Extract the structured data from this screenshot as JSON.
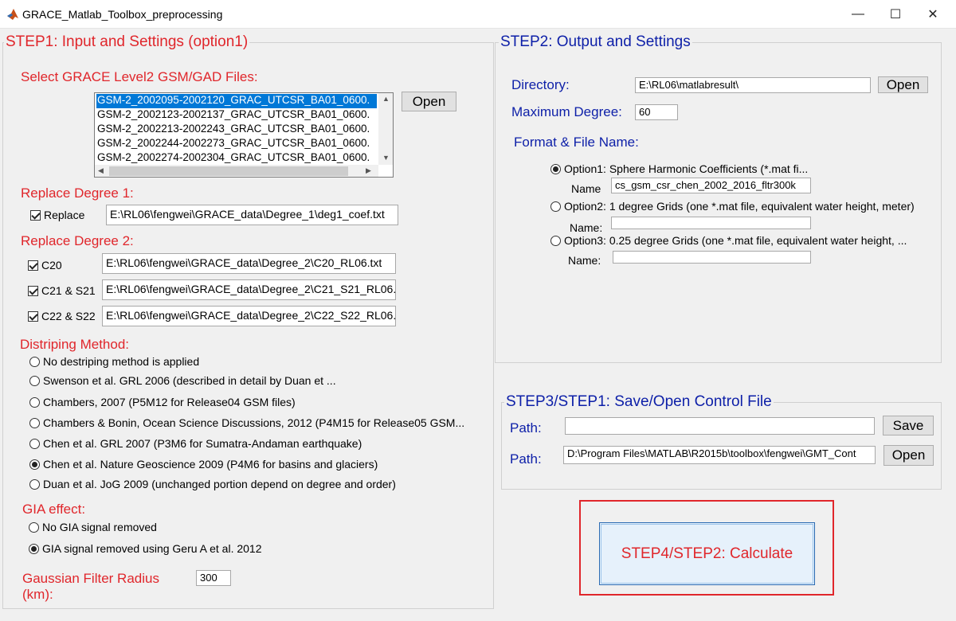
{
  "window": {
    "title": "GRACE_Matlab_Toolbox_preprocessing",
    "controls": [
      "—",
      "☐",
      "✕"
    ]
  },
  "step1": {
    "title": "STEP1: Input and Settings (option1)",
    "select_label": "Select GRACE Level2 GSM/GAD Files:",
    "files": [
      "GSM-2_2002095-2002120_GRAC_UTCSR_BA01_0600.",
      "GSM-2_2002123-2002137_GRAC_UTCSR_BA01_0600.",
      "GSM-2_2002213-2002243_GRAC_UTCSR_BA01_0600.",
      "GSM-2_2002244-2002273_GRAC_UTCSR_BA01_0600.",
      "GSM-2_2002274-2002304_GRAC_UTCSR_BA01_0600."
    ],
    "open_label": "Open",
    "replace_deg1_label": "Replace Degree 1:",
    "replace_label": "Replace",
    "replace_path": "E:\\RL06\\fengwei\\GRACE_data\\Degree_1\\deg1_coef.txt",
    "replace_deg2_label": "Replace Degree 2:",
    "c20_label": "C20",
    "c20_path": "E:\\RL06\\fengwei\\GRACE_data\\Degree_2\\C20_RL06.txt",
    "c21_label": "C21 & S21",
    "c21_path": "E:\\RL06\\fengwei\\GRACE_data\\Degree_2\\C21_S21_RL06.",
    "c22_label": "C22 & S22",
    "c22_path": "E:\\RL06\\fengwei\\GRACE_data\\Degree_2\\C22_S22_RL06.",
    "destripe_label": "Distriping Method:",
    "destripe_options": [
      "No destriping method is applied",
      "Swenson et al. GRL 2006 (described in detail by Duan et ...",
      "Chambers, 2007 (P5M12 for Release04 GSM files)",
      "Chambers & Bonin, Ocean Science Discussions, 2012 (P4M15 for Release05 GSM...",
      "Chen et al. GRL 2007 (P3M6 for Sumatra-Andaman earthquake)",
      "Chen et al. Nature Geoscience 2009 (P4M6 for basins and glaciers)",
      "Duan et al. JoG 2009 (unchanged portion depend on degree and order)"
    ],
    "gia_label": "GIA effect:",
    "gia_options": [
      "No GIA signal removed",
      "GIA signal removed using Geru A et al. 2012"
    ],
    "gauss_label_1": "Gaussian Filter Radius",
    "gauss_label_2": "(km):",
    "gauss_value": "300"
  },
  "step2": {
    "title": "STEP2: Output and Settings",
    "directory_label": "Directory:",
    "directory_value": "E:\\RL06\\matlabresult\\",
    "open_label": "Open",
    "maxdeg_label": "Maximum Degree:",
    "maxdeg_value": "60",
    "format_label": "Format & File Name:",
    "option1": "Option1: Sphere Harmonic Coefficients (*.mat fi...",
    "name1_label": "Name",
    "name1_value": "cs_gsm_csr_chen_2002_2016_fltr300k",
    "option2": "Option2: 1 degree Grids (one *.mat file, equivalent water height, meter)",
    "name2_label": "Name:",
    "option3": "Option3: 0.25 degree Grids (one *.mat file, equivalent water height, ...",
    "name3_label": "Name:"
  },
  "step3": {
    "title": "STEP3/STEP1: Save/Open Control File",
    "path1_label": "Path:",
    "path1_value": "",
    "save_label": "Save",
    "path2_label": "Path:",
    "path2_value": "D:\\Program Files\\MATLAB\\R2015b\\toolbox\\fengwei\\GMT_Cont",
    "open_label": "Open"
  },
  "step4": {
    "calculate_label": "STEP4/STEP2: Calculate"
  },
  "colors": {
    "red_text": "#e0262b",
    "blue_text": "#0d1fa8",
    "selection": "#0078d7"
  }
}
